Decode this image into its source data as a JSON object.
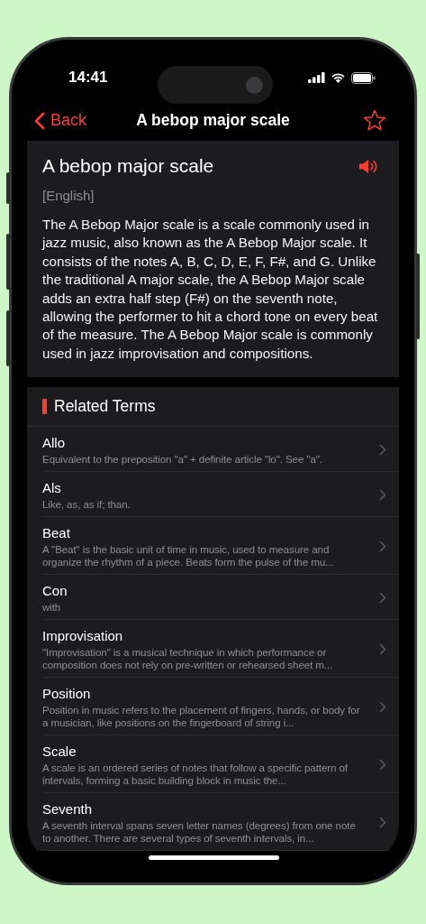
{
  "status_bar": {
    "time": "14:41"
  },
  "nav_bar": {
    "back_label": "Back",
    "title": "A bebop major scale",
    "favorite": false
  },
  "entry": {
    "term": "A bebop major scale",
    "language": "[English]",
    "definition": "The A Bebop Major scale is a scale commonly used in jazz music, also known as the A Bebop Major scale. It consists of the notes A, B, C, D, E, F, F#, and G. Unlike the traditional A major scale, the A Bebop Major scale adds an extra half step (F#) on the seventh note, allowing the performer to hit a chord tone on every beat of the measure. The A Bebop Major scale is commonly used in jazz improvisation and compositions."
  },
  "related": {
    "title": "Related Terms",
    "items": [
      {
        "term": "Allo",
        "description": "Equivalent to the preposition \"a\" + definite article \"lo\". See \"a\"."
      },
      {
        "term": "Als",
        "description": "Like, as, as if; than."
      },
      {
        "term": "Beat",
        "description": "A \"Beat\" is the basic unit of time in music, used to measure and organize the rhythm of a piece. Beats form the pulse of the mu..."
      },
      {
        "term": "Con",
        "description": "with"
      },
      {
        "term": "Improvisation",
        "description": "\"Improvisation\" is a musical technique in which performance or composition does not rely on pre-written or rehearsed sheet m..."
      },
      {
        "term": "Position",
        "description": "Position in music refers to the placement of fingers, hands, or body for a musician, like positions on the fingerboard of string i..."
      },
      {
        "term": "Scale",
        "description": "A scale is an ordered series of notes that follow a specific pattern of intervals, forming a basic building block in music the..."
      },
      {
        "term": "Seventh",
        "description": "A seventh interval spans seven letter names (degrees) from one note to another. There are several types of seventh intervals, in..."
      }
    ]
  }
}
